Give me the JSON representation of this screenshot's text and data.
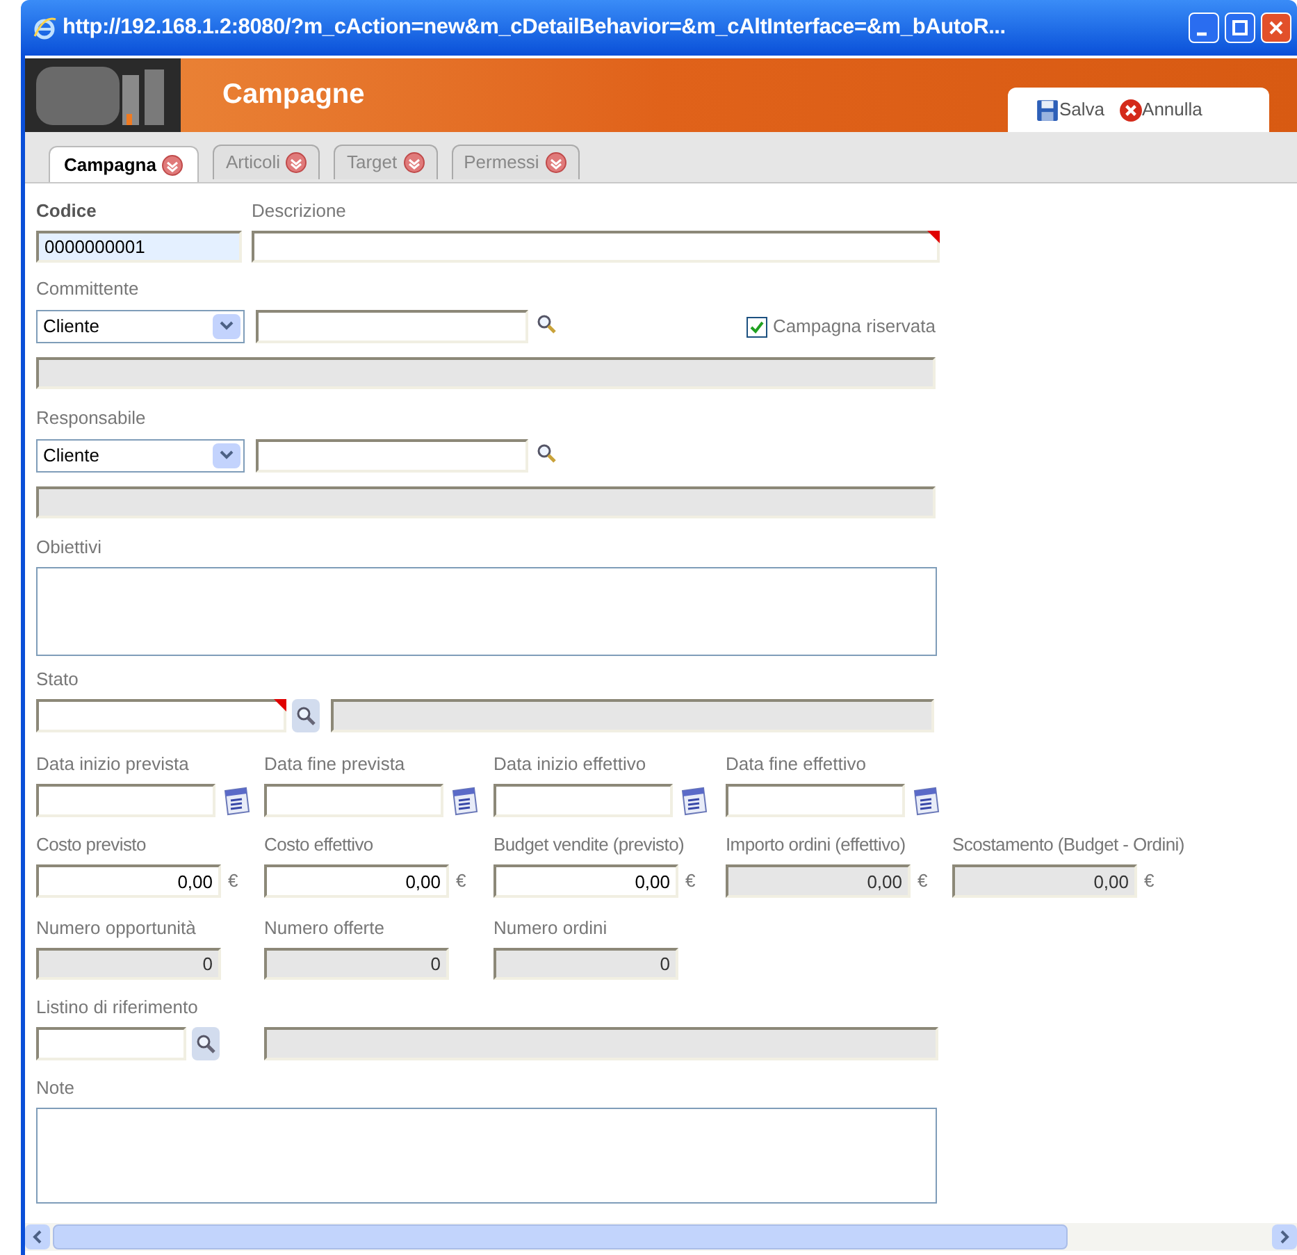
{
  "window": {
    "title": "http://192.168.1.2:8080/?m_cAction=new&m_cDetailBehavior=&m_cAltInterface=&m_bAutoR..."
  },
  "header": {
    "title": "Campagne",
    "actions": [
      {
        "label": "Salva",
        "kind": "save"
      },
      {
        "label": "Annulla",
        "kind": "cancel"
      }
    ]
  },
  "tabs": [
    {
      "label": "Campagna",
      "selected": true
    },
    {
      "label": "Articoli",
      "selected": false
    },
    {
      "label": "Target",
      "selected": false
    },
    {
      "label": "Permessi",
      "selected": false
    }
  ],
  "codice": {
    "label": "Codice",
    "value": "0000000001"
  },
  "descrizione": {
    "label": "Descrizione",
    "required": true
  },
  "committente": {
    "label": "Committente",
    "type": "Cliente"
  },
  "riservata": {
    "label": "Campagna riservata",
    "checked": true
  },
  "responsabile": {
    "label": "Responsabile",
    "type": "Cliente"
  },
  "obiettivi": {
    "label": "Obiettivi"
  },
  "stato": {
    "label": "Stato",
    "required": true
  },
  "dates": [
    {
      "label": "Data inizio prevista"
    },
    {
      "label": "Data fine prevista"
    },
    {
      "label": "Data inizio effettivo"
    },
    {
      "label": "Data fine effettivo"
    }
  ],
  "amounts": [
    {
      "label": "Costo previsto",
      "value": "0,00",
      "currency": "€",
      "disabled": false
    },
    {
      "label": "Costo effettivo",
      "value": "0,00",
      "currency": "€",
      "disabled": false
    },
    {
      "label": "Budget vendite (previsto)",
      "value": "0,00",
      "currency": "€",
      "disabled": false
    },
    {
      "label": "Importo ordini (effettivo)",
      "value": "0,00",
      "currency": "€",
      "disabled": true
    },
    {
      "label": "Scostamento (Budget - Ordini)",
      "value": "0,00",
      "currency": "€",
      "disabled": true
    }
  ],
  "counts": [
    {
      "label": "Numero opportunità",
      "value": "0",
      "disabled": true
    },
    {
      "label": "Numero offerte",
      "value": "0",
      "disabled": true
    },
    {
      "label": "Numero ordini",
      "value": "0",
      "disabled": true
    }
  ],
  "listino": {
    "label": "Listino di riferimento"
  },
  "note": {
    "label": "Note"
  }
}
